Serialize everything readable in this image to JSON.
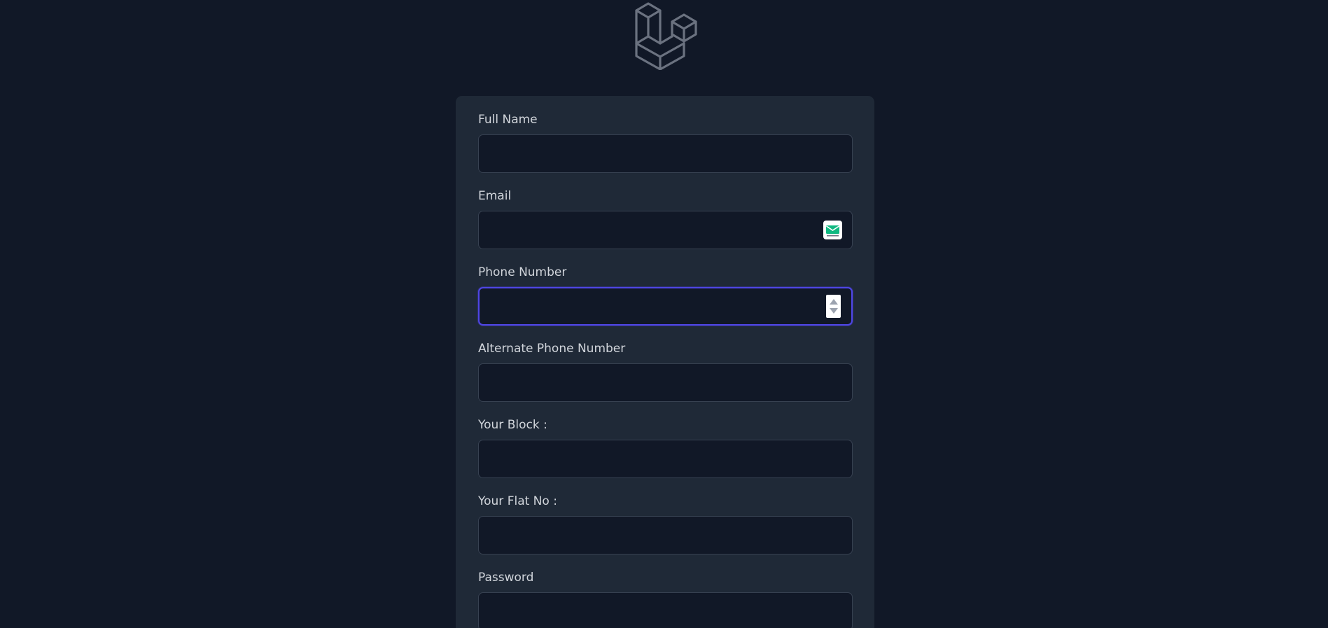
{
  "colors": {
    "background": "#111827",
    "card": "#1f2937",
    "input_background": "#111827",
    "input_border": "#374151",
    "focus_ring": "#4f46e5",
    "label_text": "#d1d5db",
    "logo_stroke": "#6b7280",
    "email_icon_accent": "#10b981"
  },
  "logo": {
    "icon": "laravel-logo-icon"
  },
  "form": {
    "fields": [
      {
        "label": "Full Name",
        "value": "",
        "placeholder": "",
        "type": "text"
      },
      {
        "label": "Email",
        "value": "",
        "placeholder": "",
        "type": "email",
        "icon": "envelope-icon"
      },
      {
        "label": "Phone Number",
        "value": "",
        "placeholder": "",
        "type": "number",
        "focused": true
      },
      {
        "label": "Alternate Phone Number",
        "value": "",
        "placeholder": "",
        "type": "text"
      },
      {
        "label": "Your Block :",
        "value": "",
        "placeholder": "",
        "type": "text"
      },
      {
        "label": "Your Flat No :",
        "value": "",
        "placeholder": "",
        "type": "text"
      },
      {
        "label": "Password",
        "value": "",
        "placeholder": "",
        "type": "password"
      }
    ]
  }
}
